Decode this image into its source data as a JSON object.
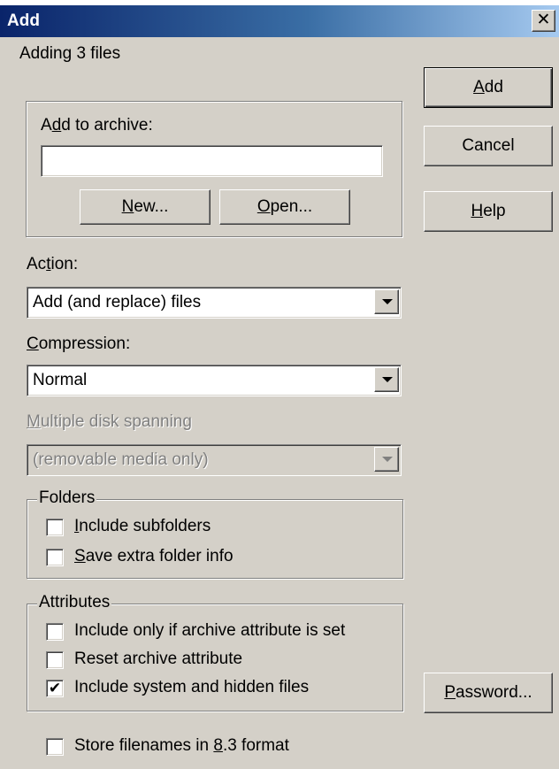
{
  "window": {
    "title": "Add",
    "close_glyph": "✕"
  },
  "status_text": "Adding 3 files",
  "archive_group": {
    "label_before": "A",
    "label_accel": "d",
    "label_after": "d to archive:",
    "input_value": "",
    "new_before": "",
    "new_accel": "N",
    "new_after": "ew...",
    "open_before": "",
    "open_accel": "O",
    "open_after": "pen..."
  },
  "buttons": {
    "add_accel": "A",
    "add_after": "dd",
    "cancel": "Cancel",
    "help_accel": "H",
    "help_after": "elp",
    "password_accel": "P",
    "password_after": "assword..."
  },
  "action": {
    "label_before": "Ac",
    "label_accel": "t",
    "label_after": "ion:",
    "value": "Add (and replace) files"
  },
  "compression": {
    "label_accel": "C",
    "label_after": "ompression:",
    "value": "Normal"
  },
  "spanning": {
    "label_accel": "M",
    "label_after": "ultiple disk spanning",
    "value": "(removable media only)",
    "enabled": false
  },
  "folders": {
    "title": "Folders",
    "items": [
      {
        "accel": "I",
        "after": "nclude subfolders",
        "checked": false
      },
      {
        "accel": "S",
        "after": "ave extra folder info",
        "checked": false
      }
    ]
  },
  "attributes": {
    "title": "Attributes",
    "items": [
      {
        "label": "Include only if archive attribute is set",
        "checked": false
      },
      {
        "label": "Reset archive attribute",
        "checked": false
      },
      {
        "label": "Include system and hidden files",
        "checked": true
      }
    ]
  },
  "store83": {
    "before": "Store filenames in ",
    "accel": "8",
    "after": ".3 format",
    "checked": false
  },
  "check_glyph": "✔"
}
